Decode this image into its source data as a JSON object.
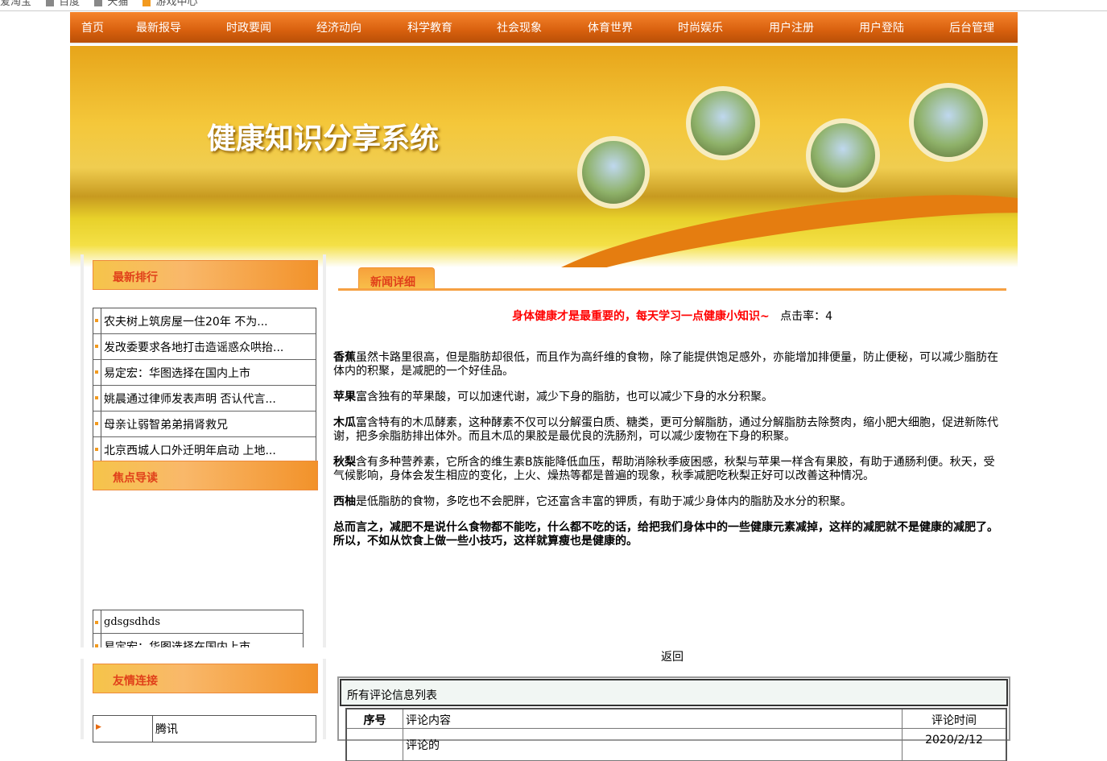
{
  "bookmarks": [
    "爱淘宝",
    "百度",
    "天猫",
    "游戏中心"
  ],
  "nav": [
    "首页",
    "最新报导",
    "时政要闻",
    "经济动向",
    "科学教育",
    "社会现象",
    "体育世界",
    "时尚娱乐",
    "用户注册",
    "用户登陆",
    "后台管理"
  ],
  "banner": {
    "title": "健康知识分享系统"
  },
  "sidebar": {
    "latest_title": "最新排行",
    "latest": [
      "农夫树上筑房屋一住20年 不为...",
      "发改委要求各地打击造谣惑众哄抬...",
      "易定宏：华图选择在国内上市",
      "姚晨通过律师发表声明 否认代言...",
      "母亲让弱智弟弟捐肾救兄",
      "北京西城人口外迁明年启动 上地..."
    ],
    "focus_title": "焦点导读",
    "focus": [
      "gdsgsdhds",
      "易定宏：华图选择在国内上市"
    ],
    "links_title": "友情连接",
    "links": [
      "腾讯"
    ]
  },
  "main": {
    "tab": "新闻详细",
    "headline": "身体健康才是最重要的，每天学习一点健康小知识~",
    "clicks_label": "点击率：",
    "clicks": "4",
    "paragraphs": [
      {
        "b": "香蕉",
        "t": "虽然卡路里很高，但是脂肪却很低，而且作为高纤维的食物，除了能提供饱足感外，亦能增加排便量，防止便秘，可以减少脂肪在体内的积聚，是减肥的一个好佳品。"
      },
      {
        "b": "苹果",
        "t": "富含独有的苹果酸，可以加速代谢，减少下身的脂肪，也可以减少下身的水分积聚。"
      },
      {
        "b": "木瓜",
        "t": "富含特有的木瓜酵素，这种酵素不仅可以分解蛋白质、糖类，更可分解脂肪，通过分解脂肪去除赘肉，缩小肥大细胞，促进新陈代谢，把多余脂肪排出体外。而且木瓜的果胶是最优良的洗肠剂，可以减少废物在下身的积聚。"
      },
      {
        "b": "秋梨",
        "t": "含有多种营养素，它所含的维生素B族能降低血压，帮助消除秋季疲困感，秋梨与苹果一样含有果胶，有助于通肠利便。秋天，受气候影响，身体会发生相应的变化，上火、燥热等都是普遍的现象，秋季减肥吃秋梨正好可以改善这种情况。"
      },
      {
        "b": "西柚",
        "t": "是低脂肪的食物，多吃也不会肥胖，它还富含丰富的钾质，有助于减少身体内的脂肪及水分的积聚。"
      },
      {
        "b": "总而言之，减肥不是说什么食物都不能吃，什么都不吃的话，给把我们身体中的一些健康元素减掉，这样的减肥就不是健康的减肥了。所以，不如从饮食上做一些小技巧，这样就算瘦也是健康的。",
        "t": ""
      }
    ],
    "back": "返回",
    "comments": {
      "caption": "所有评论信息列表",
      "headers": [
        "序号",
        "评论内容",
        "评论时间"
      ],
      "rows": [
        [
          "",
          "评论的",
          "2020/2/12"
        ]
      ]
    }
  }
}
